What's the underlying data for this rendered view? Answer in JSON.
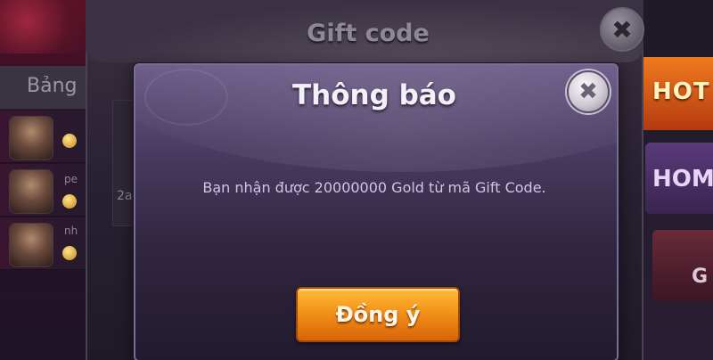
{
  "background": {
    "left_tab_label": "Bảng",
    "row_texts": [
      "pe",
      "nh"
    ],
    "side_buttons": {
      "hot": "HOT",
      "hom": "HOM",
      "tile": "G"
    }
  },
  "gift_dialog": {
    "title": "Gift code",
    "close_glyph": "✖",
    "partial_text": "2a"
  },
  "notice_dialog": {
    "title": "Thông báo",
    "close_glyph": "✖",
    "message": "Bạn nhận được 20000000 Gold từ mã Gift Code.",
    "ok_label": "Đồng ý"
  },
  "colors": {
    "accent_button": "#f39218",
    "dialog_bg": "#4a3c62",
    "message_text": "#cfc6e6"
  }
}
